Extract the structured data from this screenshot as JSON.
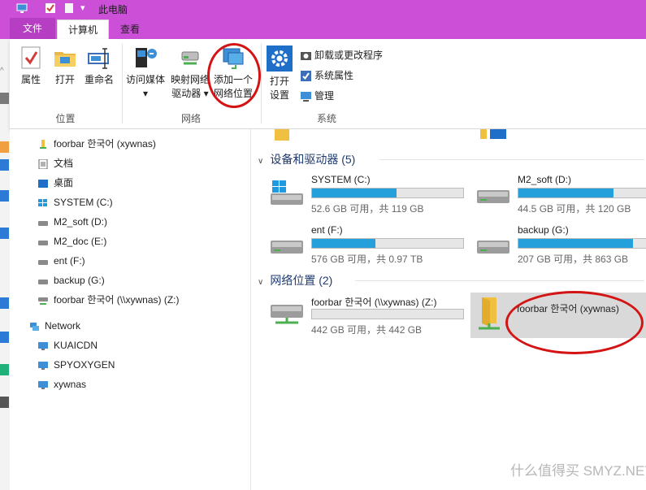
{
  "window": {
    "title": "此电脑"
  },
  "tabs": [
    {
      "label": "文件"
    },
    {
      "label": "计算机"
    },
    {
      "label": "查看"
    }
  ],
  "ribbon": {
    "location": {
      "label": "位置",
      "buttons": [
        {
          "label": "属性",
          "icon": "properties-icon"
        },
        {
          "label": "打开",
          "icon": "open-folder-icon"
        },
        {
          "label": "重命名",
          "icon": "rename-icon"
        }
      ]
    },
    "network": {
      "label": "网络",
      "access_media": {
        "line1": "访问媒体",
        "arrow": "▾"
      },
      "map_drive": {
        "line1": "映射网络",
        "line2": "驱动器",
        "arrow": "▾"
      },
      "add_location": {
        "line1": "添加一个",
        "line2": "网络位置"
      }
    },
    "system": {
      "label": "系统",
      "open_settings": {
        "line1": "打开",
        "line2": "设置"
      },
      "uninstall": "卸载或更改程序",
      "system_properties": "系统属性",
      "manage": "管理"
    }
  },
  "nav": {
    "items": [
      {
        "label": "foorbar 한국어 (xywnas)",
        "icon": "user-folder-icon"
      },
      {
        "label": "文档",
        "icon": "documents-icon"
      },
      {
        "label": "桌面",
        "icon": "desktop-icon"
      },
      {
        "label": "SYSTEM (C:)",
        "icon": "windows-drive-icon"
      },
      {
        "label": "M2_soft (D:)",
        "icon": "drive-icon"
      },
      {
        "label": "M2_doc (E:)",
        "icon": "drive-icon"
      },
      {
        "label": "ent (F:)",
        "icon": "drive-icon"
      },
      {
        "label": "backup (G:)",
        "icon": "drive-icon"
      },
      {
        "label": "foorbar 한국어 (\\\\xywnas) (Z:)",
        "icon": "network-drive-icon"
      }
    ],
    "network": {
      "label": "Network",
      "items": [
        {
          "label": "KUAICDN"
        },
        {
          "label": "SPYOXYGEN"
        },
        {
          "label": "xywnas"
        }
      ]
    }
  },
  "content": {
    "devices_section": {
      "title": "设备和驱动器 (5)"
    },
    "drives": [
      {
        "name": "SYSTEM (C:)",
        "info": "52.6 GB 可用，共 119 GB",
        "used": 0.56,
        "icon": "windows-drive-icon"
      },
      {
        "name": "M2_soft (D:)",
        "info": "44.5 GB 可用，共 120 GB",
        "used": 0.63,
        "icon": "drive-icon"
      },
      {
        "name": "ent (F:)",
        "info": "576 GB 可用，共 0.97 TB",
        "used": 0.42,
        "icon": "drive-icon"
      },
      {
        "name": "backup (G:)",
        "info": "207 GB 可用，共 863 GB",
        "used": 0.76,
        "icon": "drive-icon"
      }
    ],
    "network_section": {
      "title": "网络位置 (2)"
    },
    "net_drive": {
      "name": "foorbar 한국어 (\\\\xywnas) (Z:)",
      "info": "442 GB 可用，共 442 GB",
      "used": 0.0,
      "icon": "network-drive-icon"
    },
    "net_location": {
      "name": "foorbar 한국어 (xywnas)",
      "icon": "network-folder-icon"
    }
  },
  "watermark": "什么值得买 SMYZ.NET",
  "colors": {
    "titlebar": "#cc4fd8",
    "accent": "#26a0da",
    "annotation": "#d41414"
  }
}
